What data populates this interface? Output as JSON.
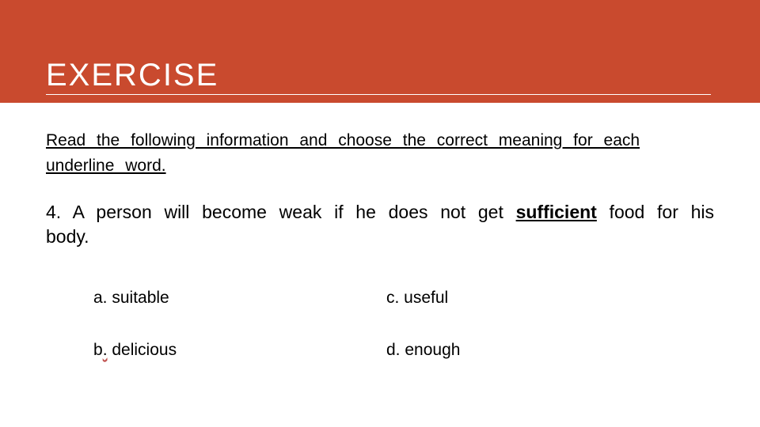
{
  "header": {
    "title": "EXERCISE"
  },
  "instruction": "Read the following information and choose the correct meaning for each underline word.",
  "question": {
    "prefix": "4. A person will become weak if he does not get ",
    "keyword": "sufficient",
    "suffix": " food for his body."
  },
  "options": {
    "a": {
      "label": "a.",
      "text": " suitable"
    },
    "b": {
      "label": "b",
      "dot": ".",
      "text": " delicious"
    },
    "c": {
      "label": "c.",
      "text": " useful"
    },
    "d": {
      "label": "d.",
      "text": " enough"
    }
  }
}
